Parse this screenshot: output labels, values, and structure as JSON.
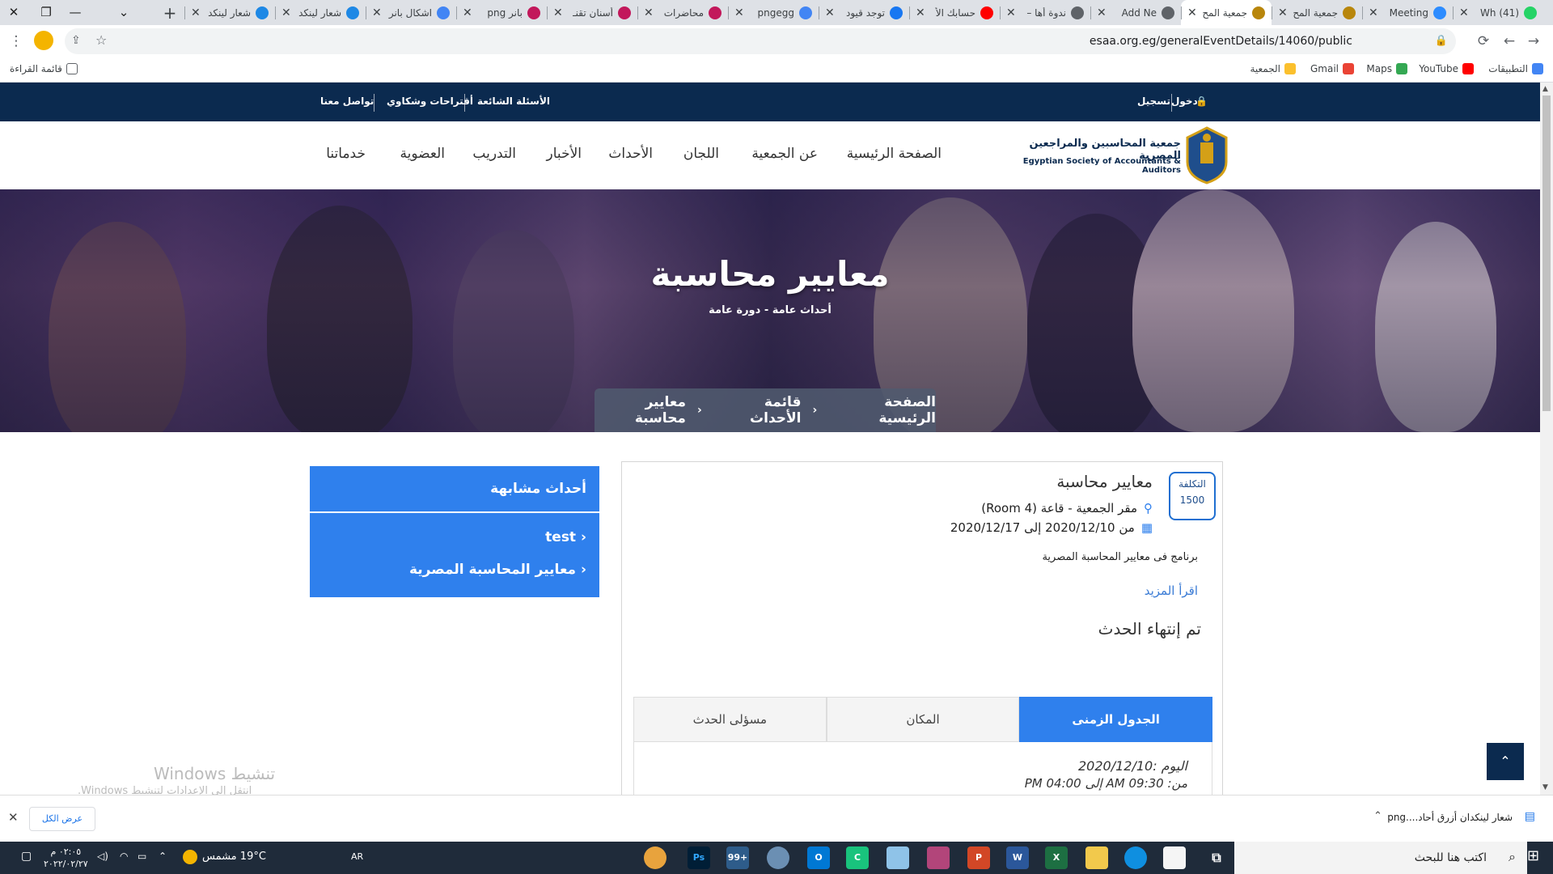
{
  "browser": {
    "tabs": [
      {
        "title": "(41) Wh",
        "color": "#25d366"
      },
      {
        "title": "Meeting",
        "color": "#2d8cff"
      },
      {
        "title": "جمعية المح",
        "color": "#b8860b"
      },
      {
        "title": "جمعية المح",
        "color": "#b8860b",
        "active": true
      },
      {
        "title": "Add Ne",
        "color": "#5f6368"
      },
      {
        "title": "ندوة أها –",
        "color": "#5f6368"
      },
      {
        "title": "حسابك الأ",
        "color": "#ff0000"
      },
      {
        "title": "توجد قيود",
        "color": "#1877f2"
      },
      {
        "title": "pngegg",
        "color": "#4285f4"
      },
      {
        "title": "محاضرات",
        "color": "#c2185b"
      },
      {
        "title": "أسنان تقنـ",
        "color": "#c2185b"
      },
      {
        "title": "بانر png",
        "color": "#c2185b"
      },
      {
        "title": "اشكال بانر",
        "color": "#4285f4"
      },
      {
        "title": "شعار لينكد",
        "color": "#1e88e5"
      },
      {
        "title": "شعار لينكد",
        "color": "#1e88e5"
      }
    ],
    "new_tab": "+",
    "url": "esaa.org.eg/generalEventDetails/14060/public",
    "bookmarks": {
      "apps": "التطبيقات",
      "youtube": "YouTube",
      "maps": "Maps",
      "gmail": "Gmail",
      "society": "الجمعية",
      "reading_list": "قائمة القراءة"
    }
  },
  "site": {
    "topbar": {
      "login": "دخول",
      "register": "تسجيل",
      "faq": "الأسئلة الشائعة",
      "suggestions": "أقتراحات وشكاوي",
      "contact": "تواصل معنا"
    },
    "logo": {
      "arabic": "جمعية المحاسبين والمراجعين المصرية",
      "english": "Egyptian Society of Accountants & Auditors"
    },
    "nav": [
      "الصفحة الرئيسية",
      "عن الجمعية",
      "اللجان",
      "الأحداث",
      "الأخبار",
      "التدريب",
      "العضوية",
      "خدماتنا"
    ],
    "hero": {
      "title": "معايير محاسبة",
      "subtitle": "أحداث عامة - دورة عامة",
      "breadcrumb": [
        "الصفحة الرئيسية",
        "قائمة الأحداث",
        "معايير محاسبة"
      ]
    },
    "event": {
      "cost_label": "التكلفة",
      "cost_value": "1500",
      "title": "معايير محاسبة",
      "location": "مقر الجمعية - قاعة (Room 4)",
      "dates": "من 2020/12/10 إلى 2020/12/17",
      "description": "برنامج فى معايير المحاسبة المصرية",
      "read_more": "اقرأ المزيد",
      "status": "تم إنتهاء الحدث",
      "tabs": [
        "الجدول الزمنى",
        "المكان",
        "مسؤلى الحدث"
      ],
      "schedule_day": "اليوم :2020/12/10",
      "schedule_time": "من: 09:30 AM إلى 04:00 PM"
    },
    "related": {
      "heading": "أحداث مشابهة",
      "items": [
        "test",
        "معايير المحاسبة المصرية"
      ]
    },
    "watermark": {
      "line1": "تنشيط Windows",
      "line2": "انتقل إلى الإعدادات لتنشيط Windows."
    }
  },
  "download_bar": {
    "file": "شعار لينكدان أزرق أحاد....png",
    "show_all": "عرض الكل"
  },
  "taskbar": {
    "search": "اكتب هنا للبحث",
    "weather": "19°C  مشمس",
    "lang": "AR",
    "time": "٠٢:٠٥ م",
    "date": "٢٠٢٢/٠٢/٢٧"
  }
}
